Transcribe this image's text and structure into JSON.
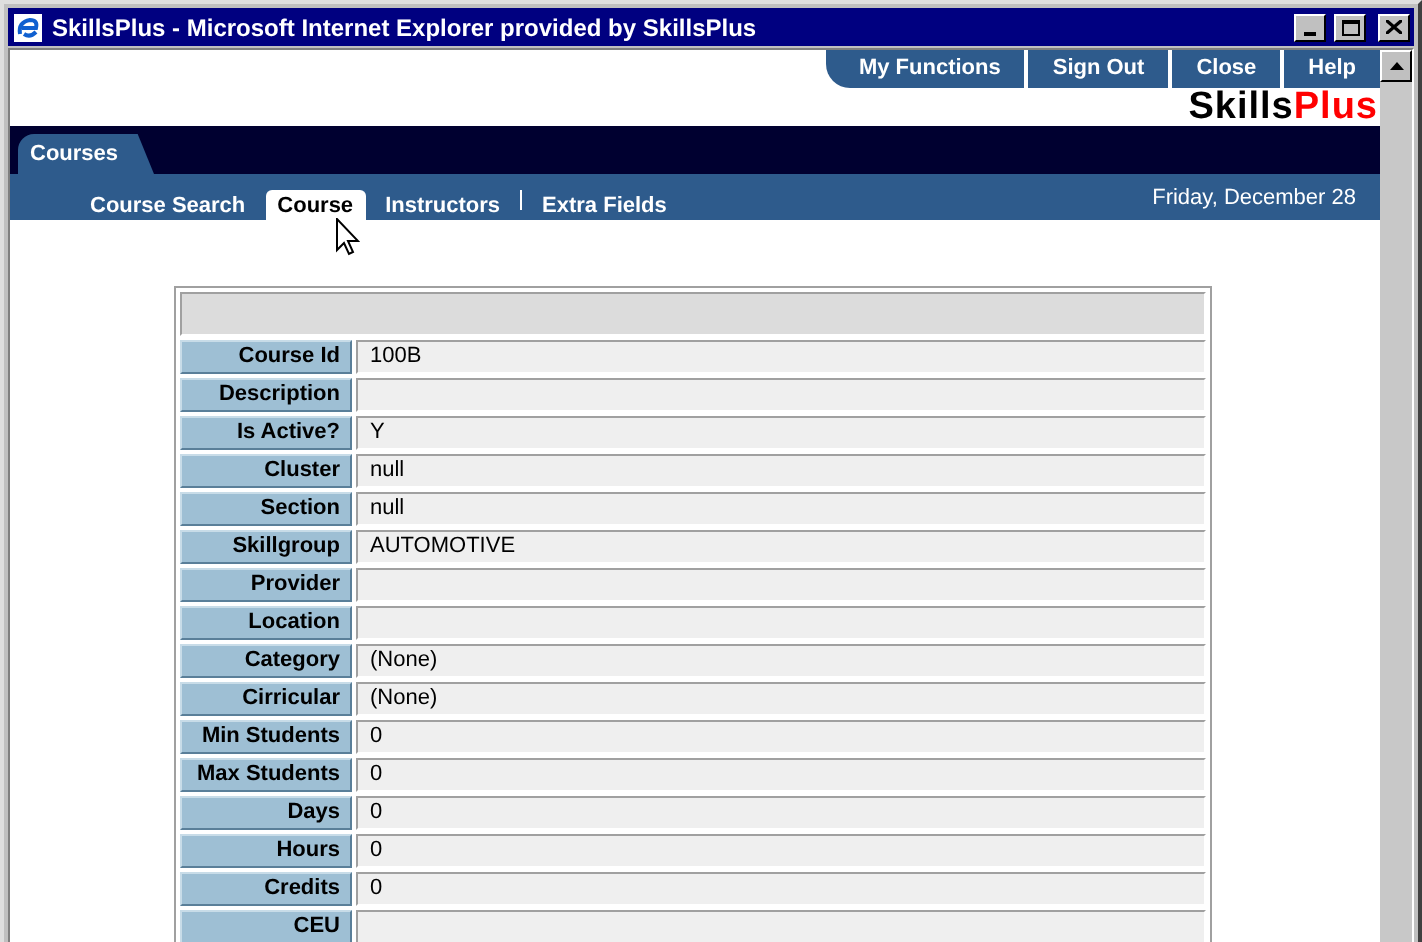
{
  "window": {
    "title": "SkillsPlus - Microsoft Internet Explorer provided by SkillsPlus"
  },
  "top_nav": [
    {
      "label": "My Functions"
    },
    {
      "label": "Sign Out"
    },
    {
      "label": "Close"
    },
    {
      "label": "Help"
    }
  ],
  "logo": {
    "part_1": "Skills",
    "part_2": "Plus"
  },
  "section_tab": {
    "label": "Courses"
  },
  "sub_tabs": [
    {
      "label": "Course Search",
      "selected": false
    },
    {
      "label": "Course",
      "selected": true
    },
    {
      "label": "Instructors",
      "selected": false
    },
    {
      "label": "Extra Fields",
      "selected": false
    }
  ],
  "date": "Friday, December 28",
  "rows": [
    {
      "label": "Course Id",
      "value": "100B"
    },
    {
      "label": "Description"
    },
    {
      "label": "Is Active?",
      "value": "Y"
    },
    {
      "label": "Cluster",
      "value": "null"
    },
    {
      "label": "Section",
      "value": "null"
    },
    {
      "label": "Skillgroup",
      "value": "AUTOMOTIVE"
    },
    {
      "label": "Provider"
    },
    {
      "label": "Location"
    },
    {
      "label": "Category",
      "value": "(None)"
    },
    {
      "label": "Cirricular",
      "value": "(None)"
    },
    {
      "label": "Min Students",
      "value": "0"
    },
    {
      "label": "Max Students",
      "value": "0"
    },
    {
      "label": "Days",
      "value": "0"
    },
    {
      "label": "Hours",
      "value": "0"
    },
    {
      "label": "Credits",
      "value": "0"
    },
    {
      "label": "CEU"
    }
  ]
}
